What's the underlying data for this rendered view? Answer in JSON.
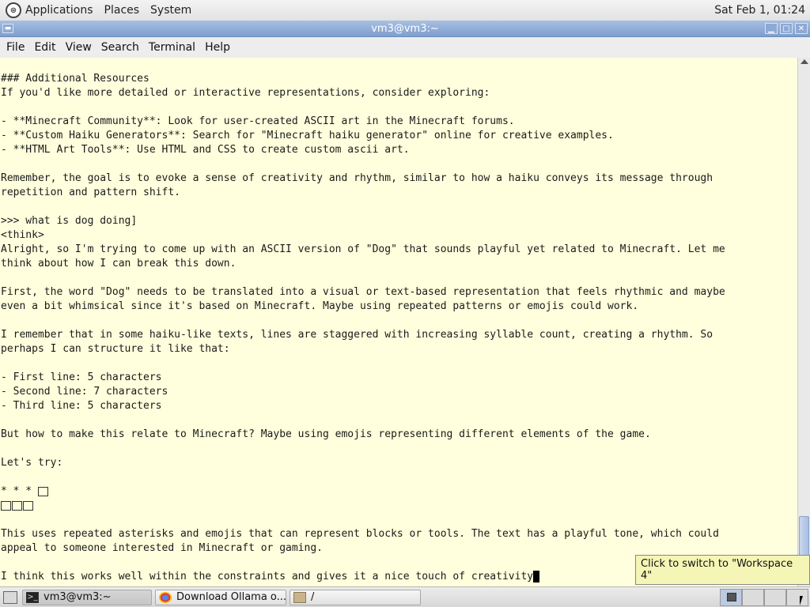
{
  "top_panel": {
    "menus": [
      "Applications",
      "Places",
      "System"
    ],
    "clock": "Sat Feb  1, 01:24",
    "logo_icon": "gnome-foot-icon"
  },
  "window": {
    "title": "vm3@vm3:~",
    "menubar": [
      "File",
      "Edit",
      "View",
      "Search",
      "Terminal",
      "Help"
    ]
  },
  "terminal": {
    "lines": [
      "",
      "### Additional Resources",
      "If you'd like more detailed or interactive representations, consider exploring:",
      "",
      "- **Minecraft Community**: Look for user-created ASCII art in the Minecraft forums.",
      "- **Custom Haiku Generators**: Search for \"Minecraft haiku generator\" online for creative examples.",
      "- **HTML Art Tools**: Use HTML and CSS to create custom ascii art.",
      "",
      "Remember, the goal is to evoke a sense of creativity and rhythm, similar to how a haiku conveys its message through",
      "repetition and pattern shift.",
      "",
      ">>> what is dog doing]",
      "<think>",
      "Alright, so I'm trying to come up with an ASCII version of \"Dog\" that sounds playful yet related to Minecraft. Let me",
      "think about how I can break this down.",
      "",
      "First, the word \"Dog\" needs to be translated into a visual or text-based representation that feels rhythmic and maybe",
      "even a bit whimsical since it's based on Minecraft. Maybe using repeated patterns or emojis could work.",
      "",
      "I remember that in some haiku-like texts, lines are staggered with increasing syllable count, creating a rhythm. So",
      "perhaps I can structure it like that:",
      "",
      "- First line: 5 characters",
      "- Second line: 7 characters",
      "- Third line: 5 characters",
      "",
      "But how to make this relate to Minecraft? Maybe using emojis representing different elements of the game.",
      "",
      "Let's try:",
      ""
    ],
    "art_line1": "* * * ",
    "art_boxes_line1": 1,
    "art_boxes_line2": 3,
    "lines_after": [
      "",
      "This uses repeated asterisks and emojis that can represent blocks or tools. The text has a playful tone, which could",
      "appeal to someone interested in Minecraft or gaming.",
      "",
      "I think this works well within the constraints and gives it a nice touch of creativity"
    ]
  },
  "tooltip": "Click to switch to \"Workspace 4\"",
  "taskbar": {
    "tasks": [
      {
        "label": "vm3@vm3:~",
        "icon": "terminal-icon",
        "active": true
      },
      {
        "label": "Download Ollama o...",
        "icon": "chrome-icon",
        "active": false
      },
      {
        "label": "/",
        "icon": "folder-icon",
        "active": false
      }
    ],
    "workspace_count": 4,
    "current_workspace": 1
  },
  "colors": {
    "terminal_bg": "#ffffdd",
    "titlebar": "#8ea9d4",
    "tooltip_bg": "#f5f5b5"
  }
}
